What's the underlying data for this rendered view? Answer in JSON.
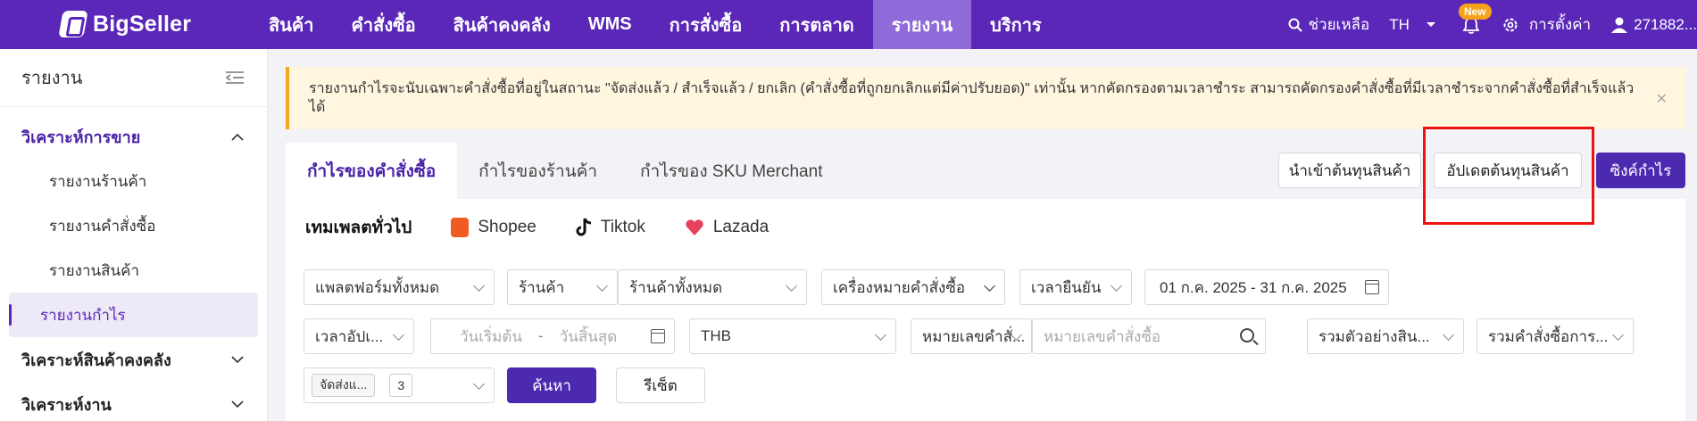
{
  "brand": {
    "name": "BigSeller"
  },
  "nav": {
    "items": [
      {
        "label": "สินค้า"
      },
      {
        "label": "คำสั่งซื้อ"
      },
      {
        "label": "สินค้าคงคลัง"
      },
      {
        "label": "WMS"
      },
      {
        "label": "การสั่งซื้อ"
      },
      {
        "label": "การตลาด"
      },
      {
        "label": "รายงาน",
        "active": true
      },
      {
        "label": "บริการ"
      }
    ],
    "help": "ช่วยเหลือ",
    "lang": "TH",
    "new_badge": "New",
    "settings": "การตั้งค่า",
    "user": "271882..."
  },
  "sidebar": {
    "title": "รายงาน",
    "groups": [
      {
        "label": "วิเคราะห์การขาย",
        "open": true,
        "items": [
          "รายงานร้านค้า",
          "รายงานคำสั่งซื้อ",
          "รายงานสินค้า",
          "รายงานกำไร"
        ]
      },
      {
        "label": "วิเคราะห์สินค้าคงคลัง"
      },
      {
        "label": "วิเคราะห์งาน"
      }
    ]
  },
  "notice": {
    "text": "รายงานกำไรจะนับเฉพาะคำสั่งซื้อที่อยู่ในสถานะ \"จัดส่งแล้ว / สำเร็จแล้ว / ยกเลิก (คำสั่งซื้อที่ถูกยกเลิกแต่มีค่าปรับยอด)\" เท่านั้น หากคัดกรองตามเวลาชำระ สามารถคัดกรองคำสั่งซื้อที่มีเวลาชำระจากคำสั่งซื้อที่สำเร็จแล้วได้"
  },
  "tabs": [
    "กำไรของคำสั่งซื้อ",
    "กำไรของร้านค้า",
    "กำไรของ SKU Merchant"
  ],
  "actions": {
    "import_cost": "นำเข้าต้นทุนสินค้า",
    "update_cost": "อัปเดตต้นทุนสินค้า",
    "sync_profit": "ซิงค์กำไร"
  },
  "subtabs": [
    "เทมเพลตทั่วไป",
    "Shopee",
    "Tiktok",
    "Lazada"
  ],
  "filters": {
    "platform": "แพลตฟอร์มทั้งหมด",
    "store_label": "ร้านค้า",
    "store_value": "ร้านค้าทั้งหมด",
    "order_mark": "เครื่องหมายคำสั่งซื้อ",
    "confirm_time": "เวลายืนยัน",
    "date_range": "01 ก.ค. 2025 - 31 ก.ค. 2025",
    "update_time": "เวลาอัปเ...",
    "start_date_ph": "วันเริ่มต้น",
    "range_sep": "-",
    "end_date_ph": "วันสิ้นสุด",
    "currency": "THB",
    "order_no_type": "หมายเลขคำสั่...",
    "order_no_ph": "หมายเลขคำสั่งซื้อ",
    "sample_sum": "รวมตัวอย่างสิน...",
    "order_sum": "รวมคำสั่งซื้อการ...",
    "status_tag": "จัดส่งแ...",
    "status_count": "3",
    "search_btn": "ค้นหา",
    "reset_btn": "รีเซ็ต"
  },
  "colors": {
    "brand": "#5a27b8",
    "primary_button": "#4c2ab0",
    "highlight": "#ee1111",
    "notice_bg": "#fff6e0"
  }
}
